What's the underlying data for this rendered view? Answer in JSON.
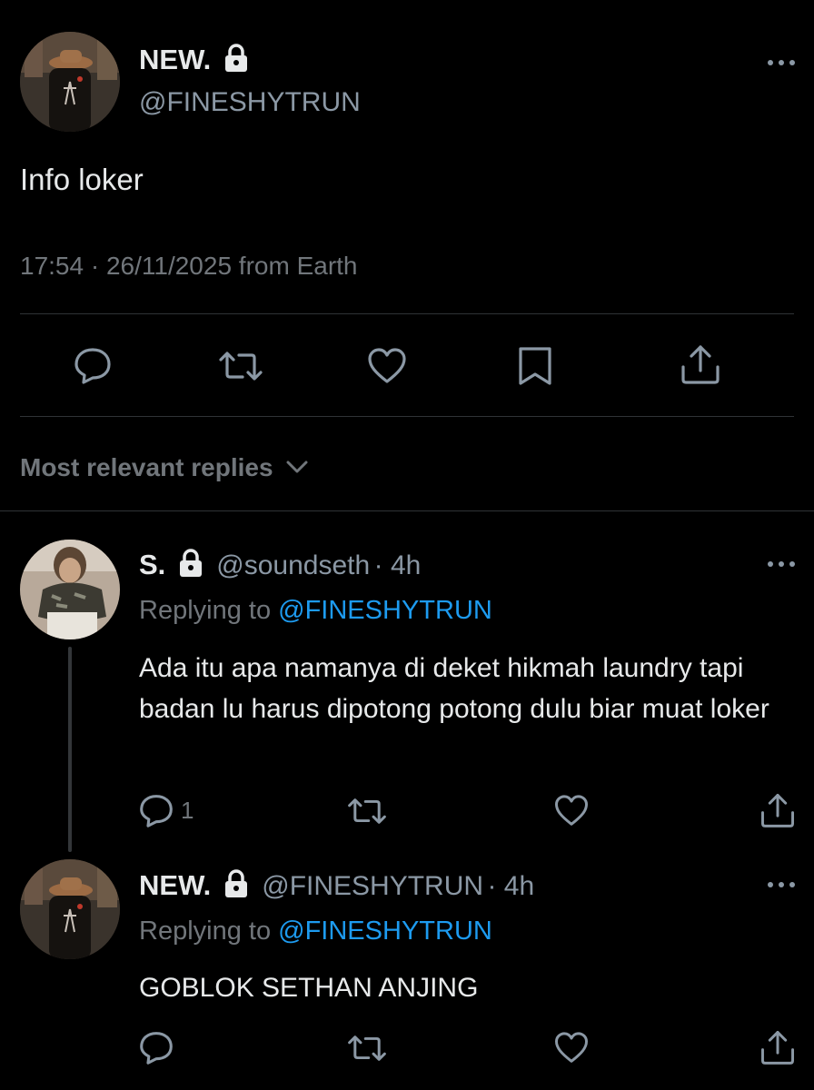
{
  "main_tweet": {
    "author_name": "NEW.",
    "author_handle": "@FINESHYTRUN",
    "text": "Info loker",
    "timestamp": "17:54 · 26/11/2025 from Earth",
    "actions": [
      "reply-icon",
      "retweet-icon",
      "like-icon",
      "bookmark-icon",
      "share-icon"
    ]
  },
  "replies_sort": {
    "label": "Most relevant replies"
  },
  "replies": [
    {
      "author_name": "S.",
      "author_handle": "@soundseth",
      "time": "· 4h",
      "replying_prefix": "Replying to",
      "replying_to": "@FINESHYTRUN",
      "text": "Ada itu apa namanya di deket hikmah laundry tapi badan lu harus dipotong potong dulu biar muat loker",
      "reply_count": "1"
    },
    {
      "author_name": "NEW.",
      "author_handle": "@FINESHYTRUN",
      "time": "· 4h",
      "replying_prefix": "Replying to",
      "replying_to": "@FINESHYTRUN",
      "text": "GOBLOK SETHAN ANJING",
      "reply_count": ""
    }
  ],
  "colors": {
    "background": "#000000",
    "text": "#e7e9ea",
    "secondary": "#71767b",
    "link": "#1d9bf0",
    "divider": "#2f3336"
  }
}
